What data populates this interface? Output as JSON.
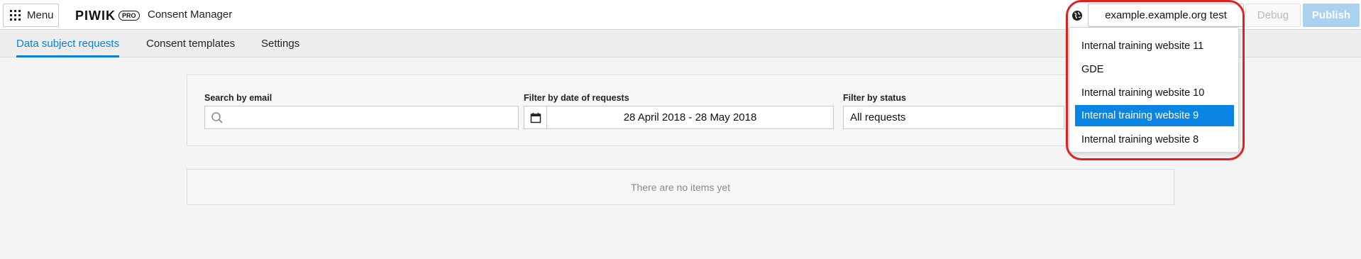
{
  "topbar": {
    "menu_label": "Menu",
    "logo_word": "PIWIK",
    "logo_badge": "PRO",
    "app_name": "Consent Manager",
    "site_selected": "example.example.org test",
    "debug_label": "Debug",
    "publish_label": "Publish"
  },
  "tabs": [
    {
      "label": "Data subject requests",
      "active": true
    },
    {
      "label": "Consent templates",
      "active": false
    },
    {
      "label": "Settings",
      "active": false
    }
  ],
  "filters": {
    "search_label": "Search by email",
    "search_value": "",
    "search_placeholder": "",
    "date_label": "Filter by date of requests",
    "date_range": "28 April 2018 - 28 May 2018",
    "status_label": "Filter by status",
    "status_value": "All requests"
  },
  "empty_message": "There are no items yet",
  "site_dropdown": {
    "items": [
      {
        "label": "Internal training website 11",
        "selected": false
      },
      {
        "label": "GDE",
        "selected": false
      },
      {
        "label": "Internal training website 10",
        "selected": false
      },
      {
        "label": "Internal training website 9",
        "selected": true
      },
      {
        "label": "Internal training website 8",
        "selected": false
      }
    ]
  },
  "colors": {
    "accent": "#0b7fd8",
    "selected_bg": "#0a85e6",
    "publish_bg": "#a9d1f0",
    "highlight": "#e22020"
  }
}
